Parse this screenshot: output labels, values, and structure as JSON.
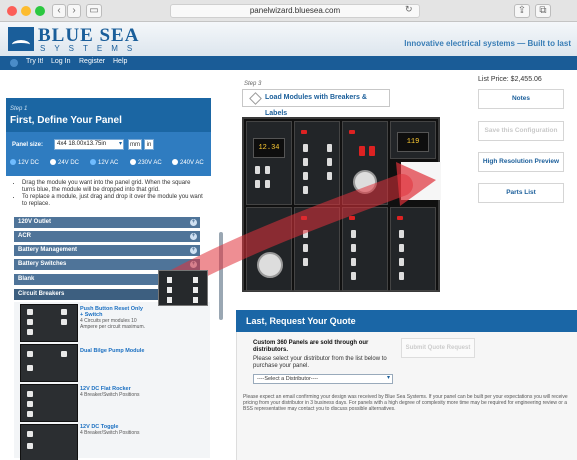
{
  "browser": {
    "url": "panelwizard.bluesea.com",
    "reload_glyph": "↻"
  },
  "header": {
    "logo_main": "BLUE SEA",
    "logo_sub": "SYSTEMS",
    "tagline": "Innovative electrical systems — Built to last"
  },
  "nav": {
    "items": [
      "Try It!",
      "Log In",
      "Register",
      "Help"
    ]
  },
  "left": {
    "step": "Step 1",
    "title": "First, Define Your Panel",
    "size_label": "Panel size:",
    "size_value": "4x4 18.00x13.75in",
    "units": [
      "mm",
      "in"
    ],
    "voltages": [
      {
        "label": "12V DC",
        "checked": true
      },
      {
        "label": "24V DC",
        "checked": false
      },
      {
        "label": "12V AC",
        "checked": true
      },
      {
        "label": "230V AC",
        "checked": false
      },
      {
        "label": "240V AC",
        "checked": false
      }
    ],
    "instructions": [
      "Drag the module you want into the panel grid. When the square turns blue, the module will be dropped into that grid.",
      "To replace a module, just drag and drop it over the module you want to replace."
    ],
    "categories": [
      "120V Outlet",
      "ACR",
      "Battery Management",
      "Battery Switches",
      "Blank",
      "Circuit Breakers"
    ],
    "modules": [
      {
        "name": "Push Button Reset Only + Switch",
        "desc": "4 Circuits per modules 10 Ampere per circuit maximum."
      },
      {
        "name": "Dual Bilge Pump Module",
        "desc": ""
      },
      {
        "name": "12V DC Flat Rocker",
        "desc": "4 Breaker/Switch Positions"
      },
      {
        "name": "12V DC Toggle",
        "desc": "4 Breaker/Switch Positions"
      }
    ]
  },
  "center": {
    "step": "Step 3",
    "load_label": "Load Modules with Breakers & Labels",
    "screen_1": "12.34",
    "screen_2": "119"
  },
  "right": {
    "price": "List Price: $2,455.06",
    "buttons": [
      "Notes",
      "Save this Configuration",
      "High Resolution Preview",
      "Parts List"
    ]
  },
  "quote": {
    "title": "Last, Request Your Quote",
    "strong": "Custom 360 Panels are sold through our distributors.",
    "text": "Please select your distributor from the list below to purchase your panel.",
    "select": "----Select a Distributor----",
    "submit": "Submit Quote Request",
    "footer": "Please expect an email confirming your design was received by Blue Sea Systems. If your panel can be built per your expectations you will receive pricing from your distributor in 3 business days. For panels with a high degree of complexity more time may be required for engineering review or a BSS representative may contact you to discuss possible alternatives."
  },
  "colors": {
    "brand": "#1a5e9a",
    "nav": "#1a5c97",
    "arrow": "#e0323a"
  }
}
